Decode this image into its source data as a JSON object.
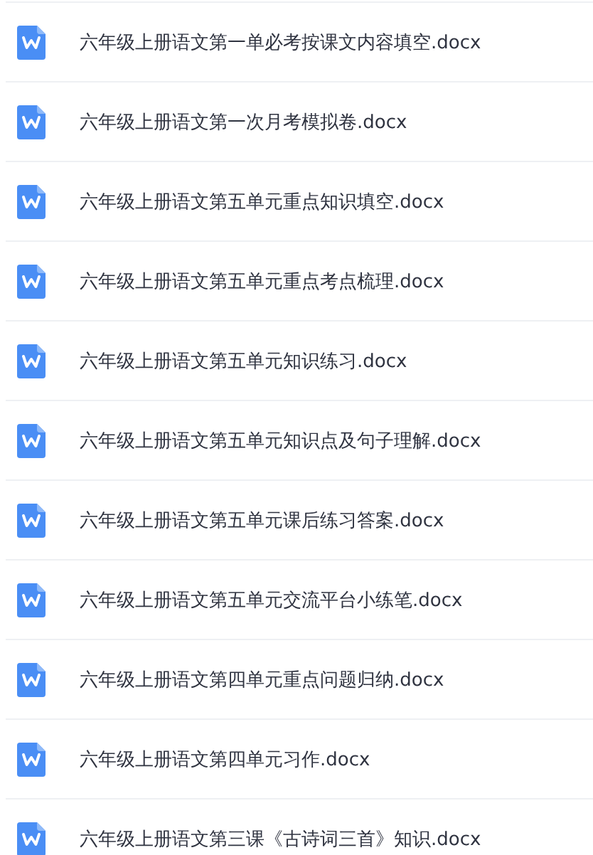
{
  "files": [
    {
      "name": "六年级上册语文第一单必考按课文内容填空.docx"
    },
    {
      "name": "六年级上册语文第一次月考模拟卷.docx"
    },
    {
      "name": "六年级上册语文第五单元重点知识填空.docx"
    },
    {
      "name": "六年级上册语文第五单元重点考点梳理.docx"
    },
    {
      "name": "六年级上册语文第五单元知识练习.docx"
    },
    {
      "name": "六年级上册语文第五单元知识点及句子理解.docx"
    },
    {
      "name": "六年级上册语文第五单元课后练习答案.docx"
    },
    {
      "name": "六年级上册语文第五单元交流平台小练笔.docx"
    },
    {
      "name": "六年级上册语文第四单元重点问题归纳.docx"
    },
    {
      "name": "六年级上册语文第四单元习作.docx"
    },
    {
      "name": "六年级上册语文第三课《古诗词三首》知识.docx"
    }
  ]
}
